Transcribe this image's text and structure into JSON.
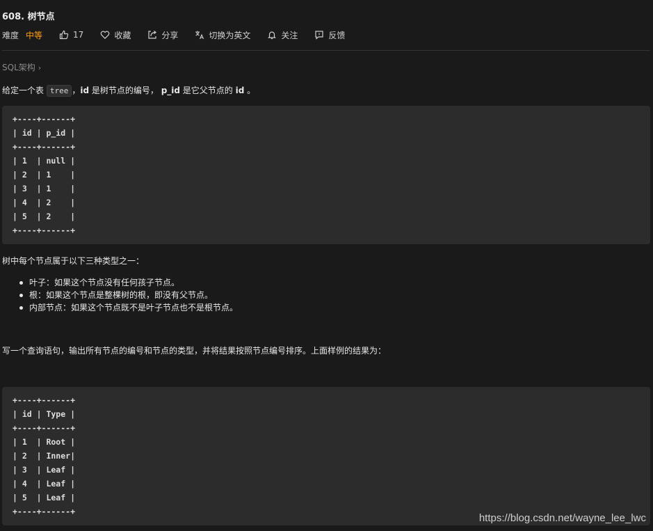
{
  "header": {
    "title": "608. 树节点",
    "difficulty_label": "难度",
    "difficulty_value": "中等",
    "like_count": "17",
    "favorite_label": "收藏",
    "share_label": "分享",
    "translate_label": "切换为英文",
    "follow_label": "关注",
    "feedback_label": "反馈"
  },
  "tag": {
    "label": "SQL架构",
    "chevron": "›"
  },
  "intro": {
    "p1": "给定一个表 ",
    "code": "tree",
    "p2": "，",
    "b1": "id",
    "p3": " 是树节点的编号， ",
    "b2": "p_id",
    "p4": " 是它父节点的 ",
    "b3": "id",
    "p5": " 。"
  },
  "table1_lines": [
    "+----+------+",
    "| id | p_id |",
    "+----+------+",
    "| 1  | null |",
    "| 2  | 1    |",
    "| 3  | 1    |",
    "| 4  | 2    |",
    "| 5  | 2    |",
    "+----+------+"
  ],
  "types_intro": "树中每个节点属于以下三种类型之一：",
  "types": [
    "叶子：如果这个节点没有任何孩子节点。",
    "根：如果这个节点是整棵树的根，即没有父节点。",
    "内部节点：如果这个节点既不是叶子节点也不是根节点。"
  ],
  "query_text": "写一个查询语句，输出所有节点的编号和节点的类型，并将结果按照节点编号排序。上面样例的结果为：",
  "table2_lines": [
    "+----+------+",
    "| id | Type |",
    "+----+------+",
    "| 1  | Root |",
    "| 2  | Inner|",
    "| 3  | Leaf |",
    "| 4  | Leaf |",
    "| 5  | Leaf |",
    "+----+------+"
  ],
  "watermark": "https://blog.csdn.net/wayne_lee_lwc",
  "colors": {
    "background": "#1a1a1a",
    "difficulty_medium": "#ffa116",
    "codebox": "#2c2c2c"
  }
}
